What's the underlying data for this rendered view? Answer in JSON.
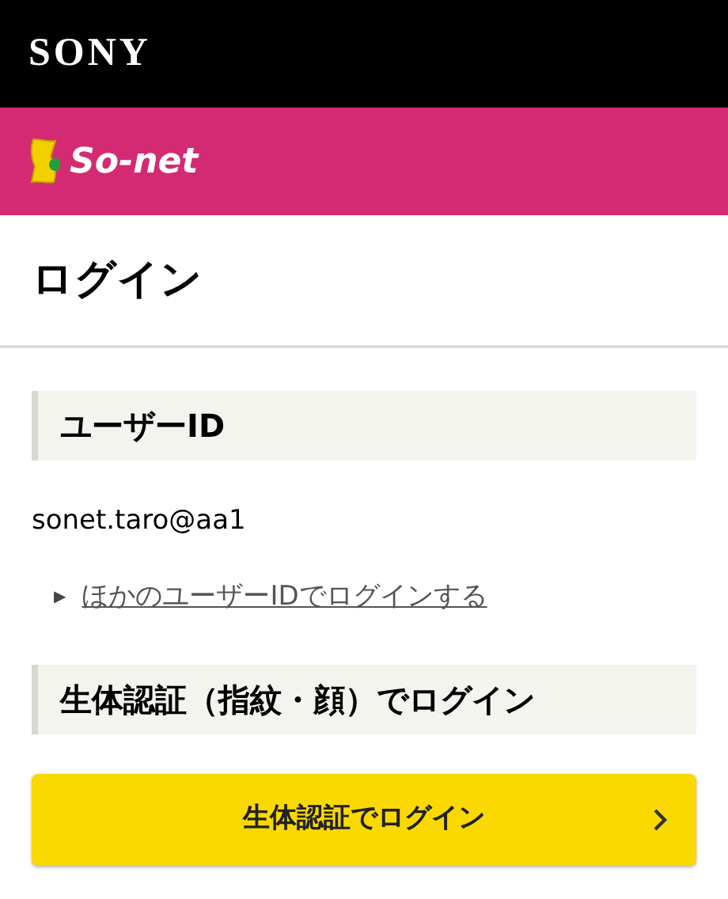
{
  "header": {
    "brand": "SONY"
  },
  "service_bar": {
    "logo_text": "So-net"
  },
  "page_title": "ログイン",
  "sections": [
    {
      "kind": "user",
      "heading": "ユーザーID",
      "user_id": "sonet.taro@aa1",
      "link": {
        "marker": "▶",
        "label": "ほかのユーザーIDでログインする"
      }
    },
    {
      "kind": "biometric",
      "heading": "生体認証（指紋・顔）でログイン",
      "button": {
        "label": "生体認証でログイン"
      }
    }
  ]
}
